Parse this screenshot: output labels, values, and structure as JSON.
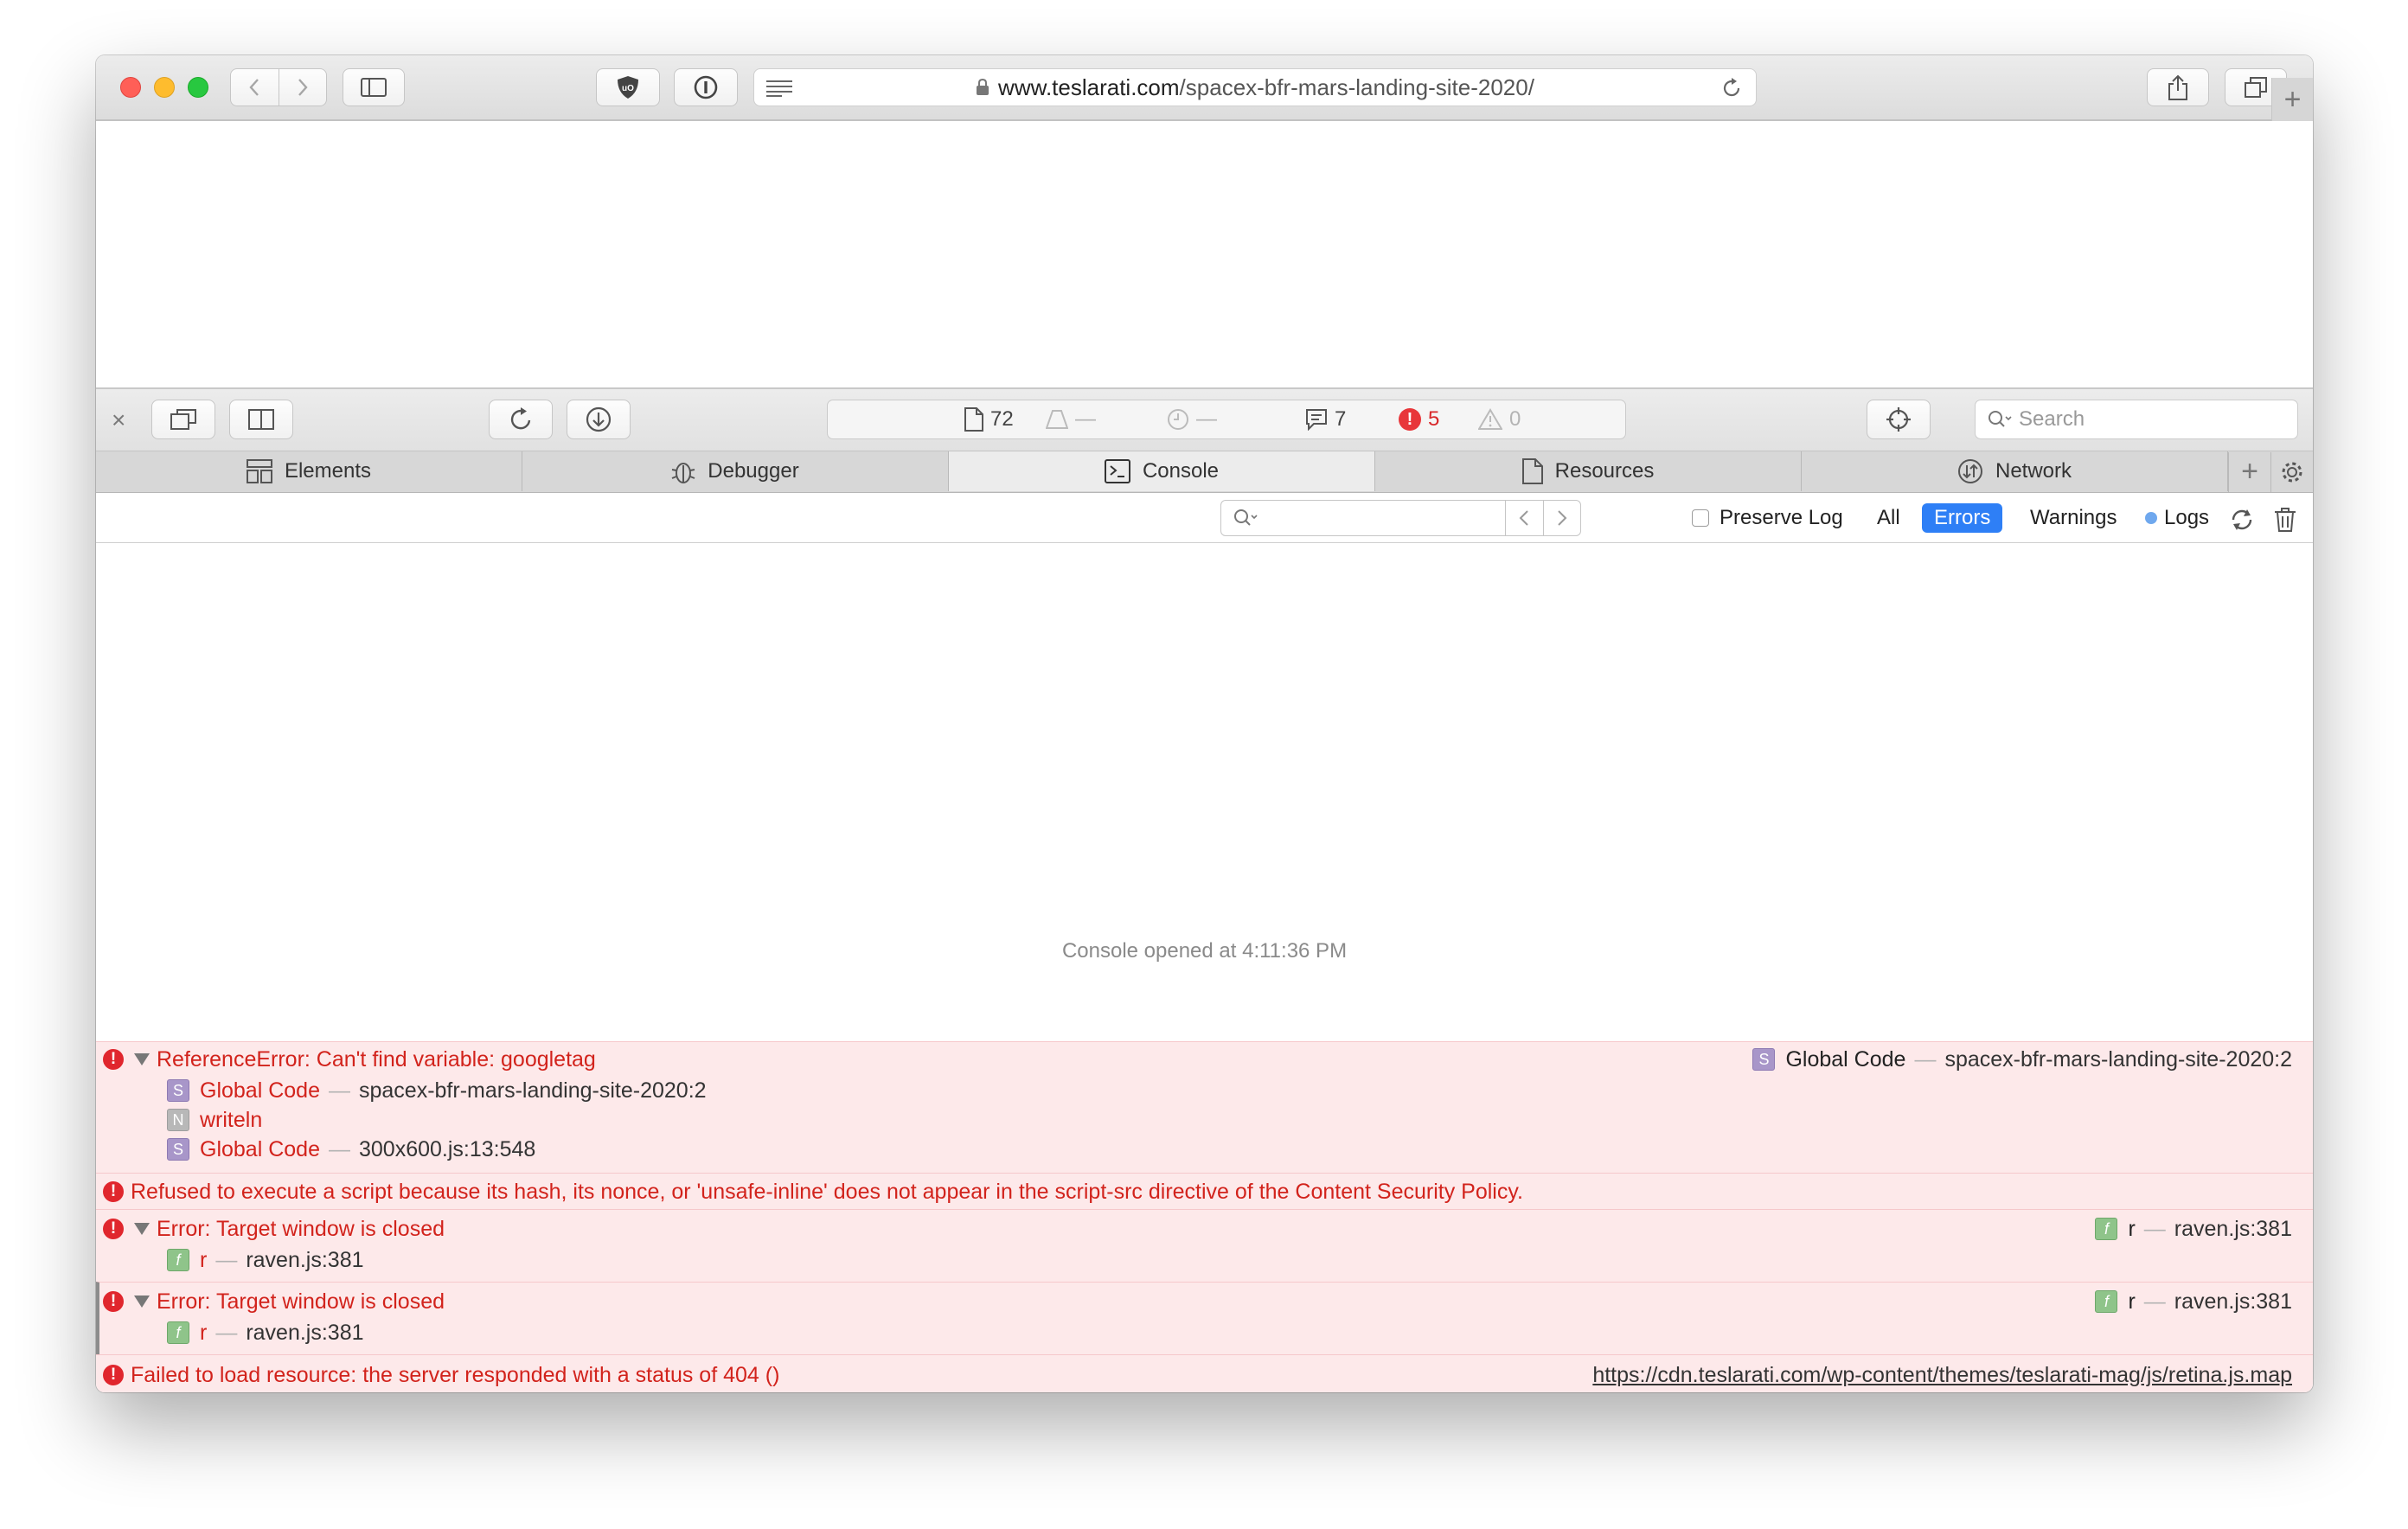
{
  "browser": {
    "url_host": "www.teslarati.com",
    "url_path": "/spacex-bfr-mars-landing-site-2020/",
    "new_tab_label": "+"
  },
  "inspector": {
    "close_label": "×",
    "dashboard": {
      "resources_count": "72",
      "resource_size": "—",
      "load_time": "—",
      "logs_count": "7",
      "errors_count": "5",
      "warnings_count": "0"
    },
    "search_placeholder": "Search",
    "tabs": [
      {
        "label": "Elements"
      },
      {
        "label": "Debugger"
      },
      {
        "label": "Console"
      },
      {
        "label": "Resources"
      },
      {
        "label": "Network"
      }
    ],
    "add_tab_label": "+"
  },
  "console": {
    "filter_placeholder": "",
    "preserve_log_label": "Preserve Log",
    "filters": {
      "all": "All",
      "errors": "Errors",
      "warnings": "Warnings",
      "logs": "Logs"
    },
    "opened_text": "Console opened at 4:11:36 PM",
    "messages": [
      {
        "text": "ReferenceError: Can't find variable: googletag",
        "right_func": "Global Code",
        "right_loc": "spacex-bfr-mars-landing-site-2020:2",
        "frames": [
          {
            "badge": "S",
            "func": "Global Code",
            "loc": "spacex-bfr-mars-landing-site-2020:2"
          },
          {
            "badge": "N",
            "func": "writeln",
            "loc": ""
          },
          {
            "badge": "S",
            "func": "Global Code",
            "loc": "300x600.js:13:548"
          }
        ]
      },
      {
        "text": "Refused to execute a script because its hash, its nonce, or 'unsafe-inline' does not appear in the script-src directive of the Content Security Policy."
      },
      {
        "text": "Error: Target window is closed",
        "right_badge": "f",
        "right_func": "r",
        "right_loc": "raven.js:381",
        "frames": [
          {
            "badge": "f",
            "func": "r",
            "loc": "raven.js:381"
          }
        ]
      },
      {
        "text": "Error: Target window is closed",
        "right_badge": "f",
        "right_func": "r",
        "right_loc": "raven.js:381",
        "frames": [
          {
            "badge": "f",
            "func": "r",
            "loc": "raven.js:381"
          }
        ]
      },
      {
        "text": "Failed to load resource: the server responded with a status of 404 ()",
        "right_link": "https://cdn.teslarati.com/wp-content/themes/teslarati-mag/js/retina.js.map"
      }
    ],
    "prompt_symbol": ">"
  },
  "colors": {
    "error_red": "#d2231c",
    "error_bg": "#fde9ea",
    "accent_blue": "#2e7ff6"
  }
}
